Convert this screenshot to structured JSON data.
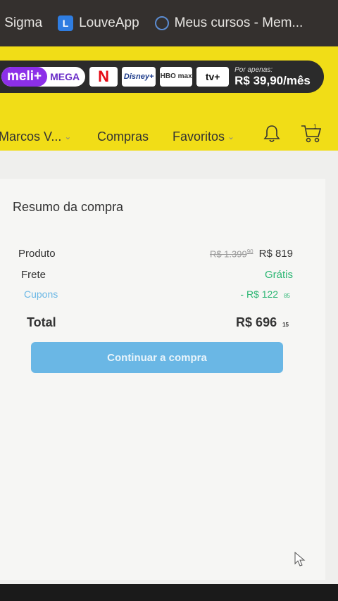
{
  "bookmarks": [
    {
      "label": "| Sigma",
      "icon": "none"
    },
    {
      "label": "LouveApp",
      "icon": "louveapp-icon"
    },
    {
      "label": "Meus cursos - Mem...",
      "icon": "globe-icon"
    }
  ],
  "banner": {
    "meli": "meli+",
    "mega": "MEGA",
    "services": [
      "N",
      "Disney+",
      "HBO max",
      "tv+"
    ],
    "price_prefix": "Por apenas:",
    "price": "R$ 39,90/mês"
  },
  "nav": {
    "user": "Marcos V...",
    "compras": "Compras",
    "favoritos": "Favoritos",
    "cart_count": "1"
  },
  "summary": {
    "title": "Resumo da compra",
    "produto_label": "Produto",
    "produto_old_price": "R$ 1.399",
    "produto_old_cents": "90",
    "produto_price": "R$ 819",
    "frete_label": "Frete",
    "frete_value": "Grátis",
    "cupons_label": "Cupons",
    "cupons_value": "- R$ 122",
    "cupons_cents": "85",
    "total_label": "Total",
    "total_value": "R$ 696",
    "total_cents": "15",
    "button_label": "Continuar a compra"
  },
  "colors": {
    "header_yellow": "#f1dd17",
    "button_blue": "#6ab7e5",
    "green": "#2bb673"
  }
}
